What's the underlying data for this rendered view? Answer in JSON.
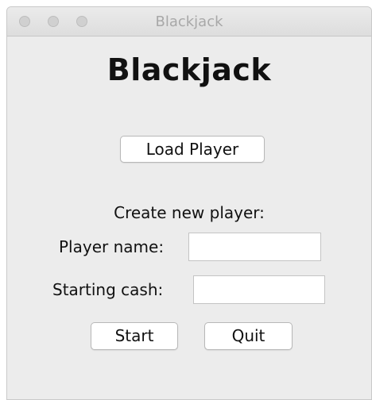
{
  "window": {
    "title": "Blackjack"
  },
  "main": {
    "heading": "Blackjack",
    "load_button_label": "Load Player",
    "create_label": "Create new player:",
    "player_name_label": "Player name:",
    "player_name_value": "",
    "starting_cash_label": "Starting cash:",
    "starting_cash_value": "",
    "start_button_label": "Start",
    "quit_button_label": "Quit"
  },
  "colors": {
    "window_background": "#ececec",
    "titlebar": "#e4e4e4",
    "title_text": "#a8a8a8",
    "button_background": "#ffffff",
    "text": "#111111"
  }
}
